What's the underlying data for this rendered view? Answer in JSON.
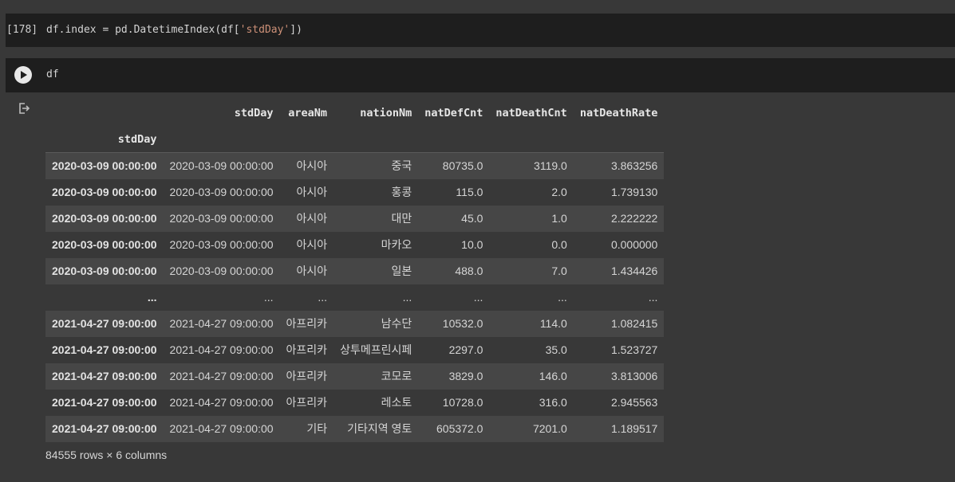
{
  "cells": [
    {
      "exec_count": "[178]",
      "code_prefix": "df.index = pd.DatetimeIndex(df[",
      "code_string": "'stdDay'",
      "code_suffix": "])"
    },
    {
      "code": "df"
    }
  ],
  "output": {
    "icon": "output-redirect-icon",
    "index_name": "stdDay",
    "columns": [
      "stdDay",
      "areaNm",
      "nationNm",
      "natDefCnt",
      "natDeathCnt",
      "natDeathRate"
    ],
    "rows": [
      {
        "index": "2020-03-09 00:00:00",
        "cells": [
          "2020-03-09 00:00:00",
          "아시아",
          "중국",
          "80735.0",
          "3119.0",
          "3.863256"
        ]
      },
      {
        "index": "2020-03-09 00:00:00",
        "cells": [
          "2020-03-09 00:00:00",
          "아시아",
          "홍콩",
          "115.0",
          "2.0",
          "1.739130"
        ]
      },
      {
        "index": "2020-03-09 00:00:00",
        "cells": [
          "2020-03-09 00:00:00",
          "아시아",
          "대만",
          "45.0",
          "1.0",
          "2.222222"
        ]
      },
      {
        "index": "2020-03-09 00:00:00",
        "cells": [
          "2020-03-09 00:00:00",
          "아시아",
          "마카오",
          "10.0",
          "0.0",
          "0.000000"
        ]
      },
      {
        "index": "2020-03-09 00:00:00",
        "cells": [
          "2020-03-09 00:00:00",
          "아시아",
          "일본",
          "488.0",
          "7.0",
          "1.434426"
        ]
      },
      {
        "index": "...",
        "cells": [
          "...",
          "...",
          "...",
          "...",
          "...",
          "..."
        ]
      },
      {
        "index": "2021-04-27 09:00:00",
        "cells": [
          "2021-04-27 09:00:00",
          "아프리카",
          "남수단",
          "10532.0",
          "114.0",
          "1.082415"
        ]
      },
      {
        "index": "2021-04-27 09:00:00",
        "cells": [
          "2021-04-27 09:00:00",
          "아프리카",
          "상투메프린시페",
          "2297.0",
          "35.0",
          "1.523727"
        ]
      },
      {
        "index": "2021-04-27 09:00:00",
        "cells": [
          "2021-04-27 09:00:00",
          "아프리카",
          "코모로",
          "3829.0",
          "146.0",
          "3.813006"
        ]
      },
      {
        "index": "2021-04-27 09:00:00",
        "cells": [
          "2021-04-27 09:00:00",
          "아프리카",
          "레소토",
          "10728.0",
          "316.0",
          "2.945563"
        ]
      },
      {
        "index": "2021-04-27 09:00:00",
        "cells": [
          "2021-04-27 09:00:00",
          "기타",
          "기타지역 영토",
          "605372.0",
          "7201.0",
          "1.189517"
        ]
      }
    ],
    "footer": "84555 rows × 6 columns"
  },
  "colors": {
    "background": "#383838",
    "code_cell": "#1e1e1e",
    "string_token": "#ce9178",
    "odd_row": "#464646"
  }
}
